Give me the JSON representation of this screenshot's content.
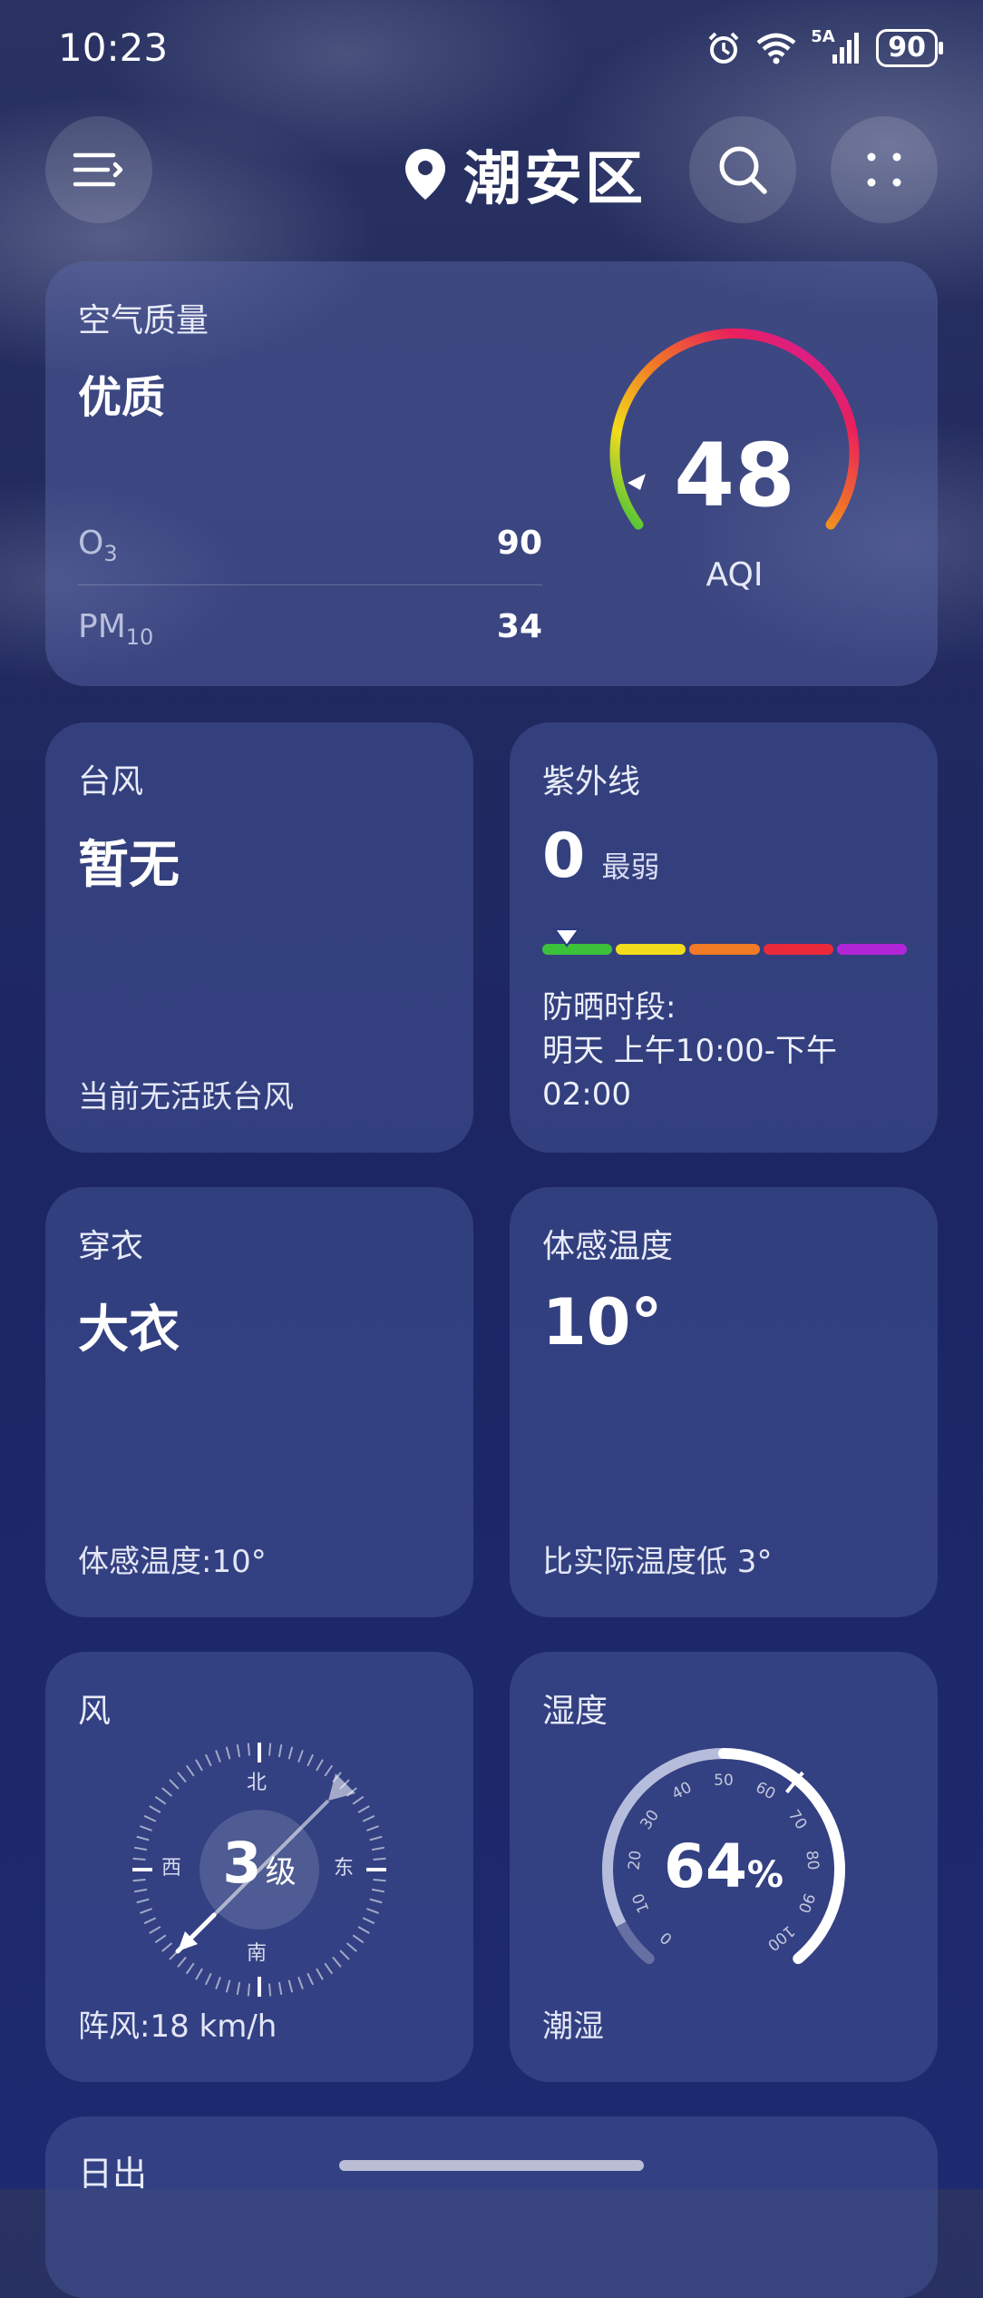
{
  "status_bar": {
    "time": "10:23",
    "network": "5A",
    "battery": "90"
  },
  "header": {
    "location": "潮安区"
  },
  "air_quality": {
    "title": "空气质量",
    "level": "优质",
    "aqi": "48",
    "aqi_label": "AQI",
    "pollutants": [
      {
        "name": "O",
        "sub": "3",
        "value": "90"
      },
      {
        "name": "PM",
        "sub": "10",
        "value": "34"
      }
    ]
  },
  "typhoon": {
    "title": "台风",
    "value": "暂无",
    "note": "当前无活跃台风"
  },
  "uv": {
    "title": "紫外线",
    "value": "0",
    "level": "最弱",
    "level_index": 0,
    "bar_colors": [
      "#3cc13b",
      "#f3dc1b",
      "#f07a25",
      "#ea2a3a",
      "#b225d6"
    ],
    "protect_label": "防晒时段:",
    "protect_time_1": "明天 上午10:00-下午",
    "protect_time_2": "02:00"
  },
  "clothing": {
    "title": "穿衣",
    "value": "大衣",
    "note": "体感温度:10°"
  },
  "feels_like": {
    "title": "体感温度",
    "value": "10°",
    "note": "比实际温度低 3°"
  },
  "wind": {
    "title": "风",
    "level": "3",
    "unit": "级",
    "dirs": {
      "n": "北",
      "s": "南",
      "w": "西",
      "e": "东"
    },
    "gust": "阵风:18 km/h"
  },
  "humidity": {
    "title": "湿度",
    "value": "64",
    "unit": "%",
    "note": "潮湿",
    "ticks": [
      "0",
      "10",
      "20",
      "30",
      "40",
      "50",
      "60",
      "70",
      "80",
      "90",
      "100"
    ]
  },
  "sunrise": {
    "title": "日出"
  }
}
